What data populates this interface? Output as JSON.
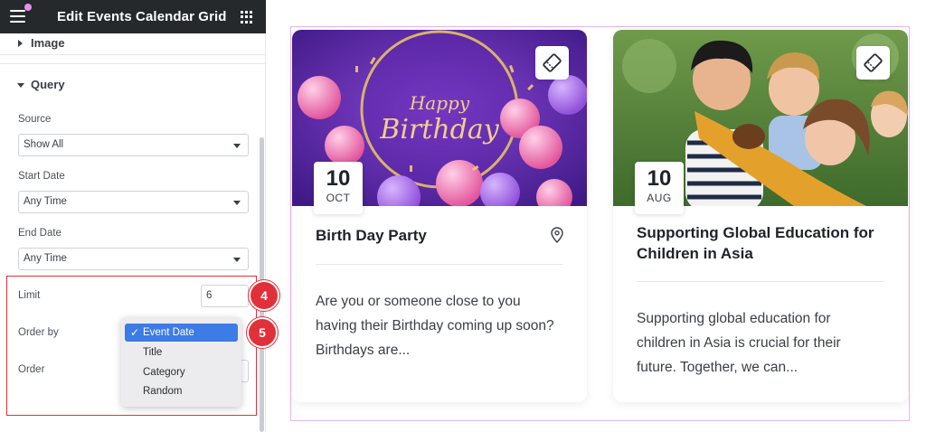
{
  "panel": {
    "title": "Edit Events Calendar Grid",
    "sections": {
      "image": "Image",
      "query": "Query"
    },
    "fields": {
      "source": {
        "label": "Source",
        "value": "Show All"
      },
      "start_date": {
        "label": "Start Date",
        "value": "Any Time"
      },
      "end_date": {
        "label": "End Date",
        "value": "Any Time"
      },
      "limit": {
        "label": "Limit",
        "value": "6"
      },
      "order_by": {
        "label": "Order by",
        "value": "Event Date"
      },
      "order": {
        "label": "Order"
      }
    },
    "order_by_options": [
      "Event Date",
      "Title",
      "Category",
      "Random"
    ],
    "badges": {
      "limit_step": "4",
      "order_by_step": "5"
    }
  },
  "events": [
    {
      "day": "10",
      "month": "OCT",
      "title": "Birth Day Party",
      "image_text_line1": "Happy",
      "image_text_line2": "Birthday",
      "description": "Are you or someone close to you having their Birthday coming up soon? Birthdays are..."
    },
    {
      "day": "10",
      "month": "AUG",
      "title": "Supporting Global Education for Children in Asia",
      "description": "Supporting global education for children in Asia is crucial for their future. Together, we can..."
    }
  ],
  "colors": {
    "panel_header": "#26292c",
    "highlight": "#e0313b",
    "selected_option": "#3d7be6",
    "preview_border": "#e8b8ec"
  }
}
